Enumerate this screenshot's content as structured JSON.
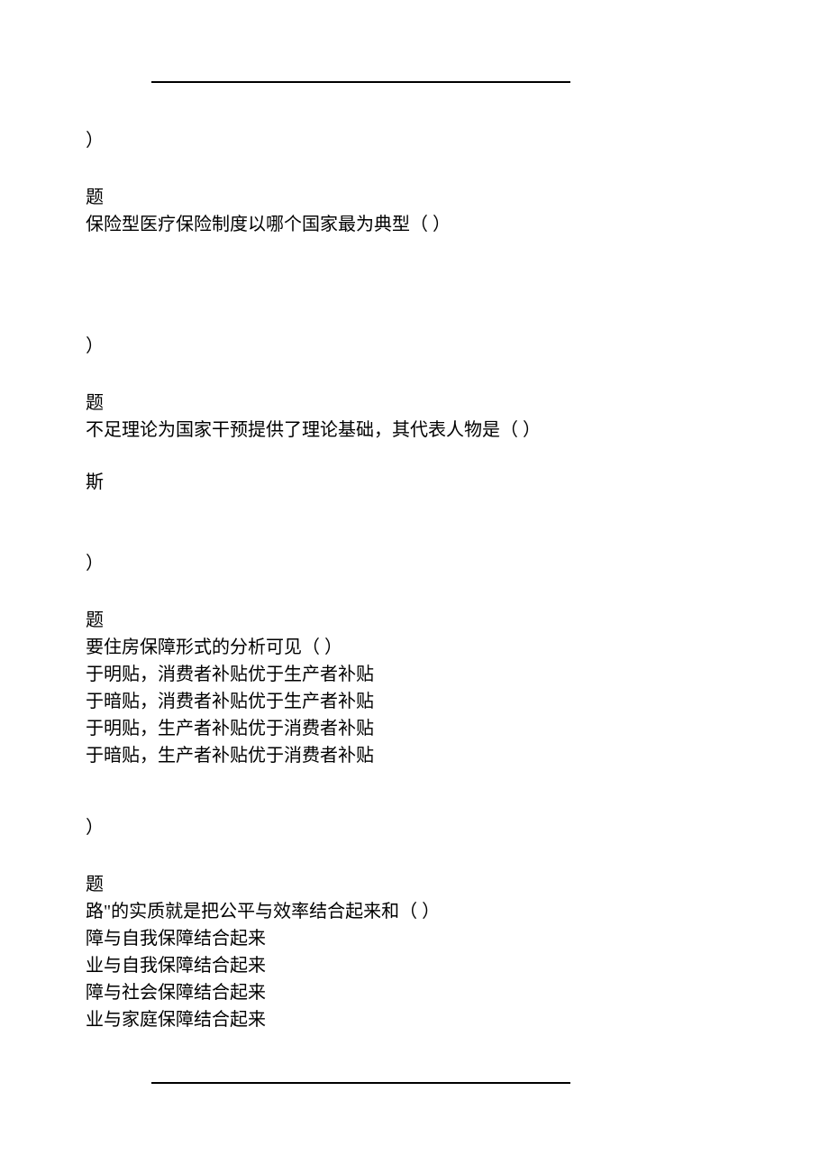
{
  "paren_text": "）",
  "q1": {
    "label": "题",
    "text": "保险型医疗保险制度以哪个国家最为典型（ ）"
  },
  "q2": {
    "label": "题",
    "text": "不足理论为国家干预提供了理论基础，其代表人物是（ ）",
    "option_fragment": "斯"
  },
  "q3": {
    "label": "题",
    "text": "要住房保障形式的分析可见（ ）",
    "options": [
      "于明贴，消费者补贴优于生产者补贴",
      "于暗贴，消费者补贴优于生产者补贴",
      "于明贴，生产者补贴优于消费者补贴",
      "于暗贴，生产者补贴优于消费者补贴"
    ]
  },
  "q4": {
    "label": "题",
    "text": "路\"的实质就是把公平与效率结合起来和（ ）",
    "options": [
      "障与自我保障结合起来",
      "业与自我保障结合起来",
      "障与社会保障结合起来",
      "业与家庭保障结合起来"
    ]
  }
}
